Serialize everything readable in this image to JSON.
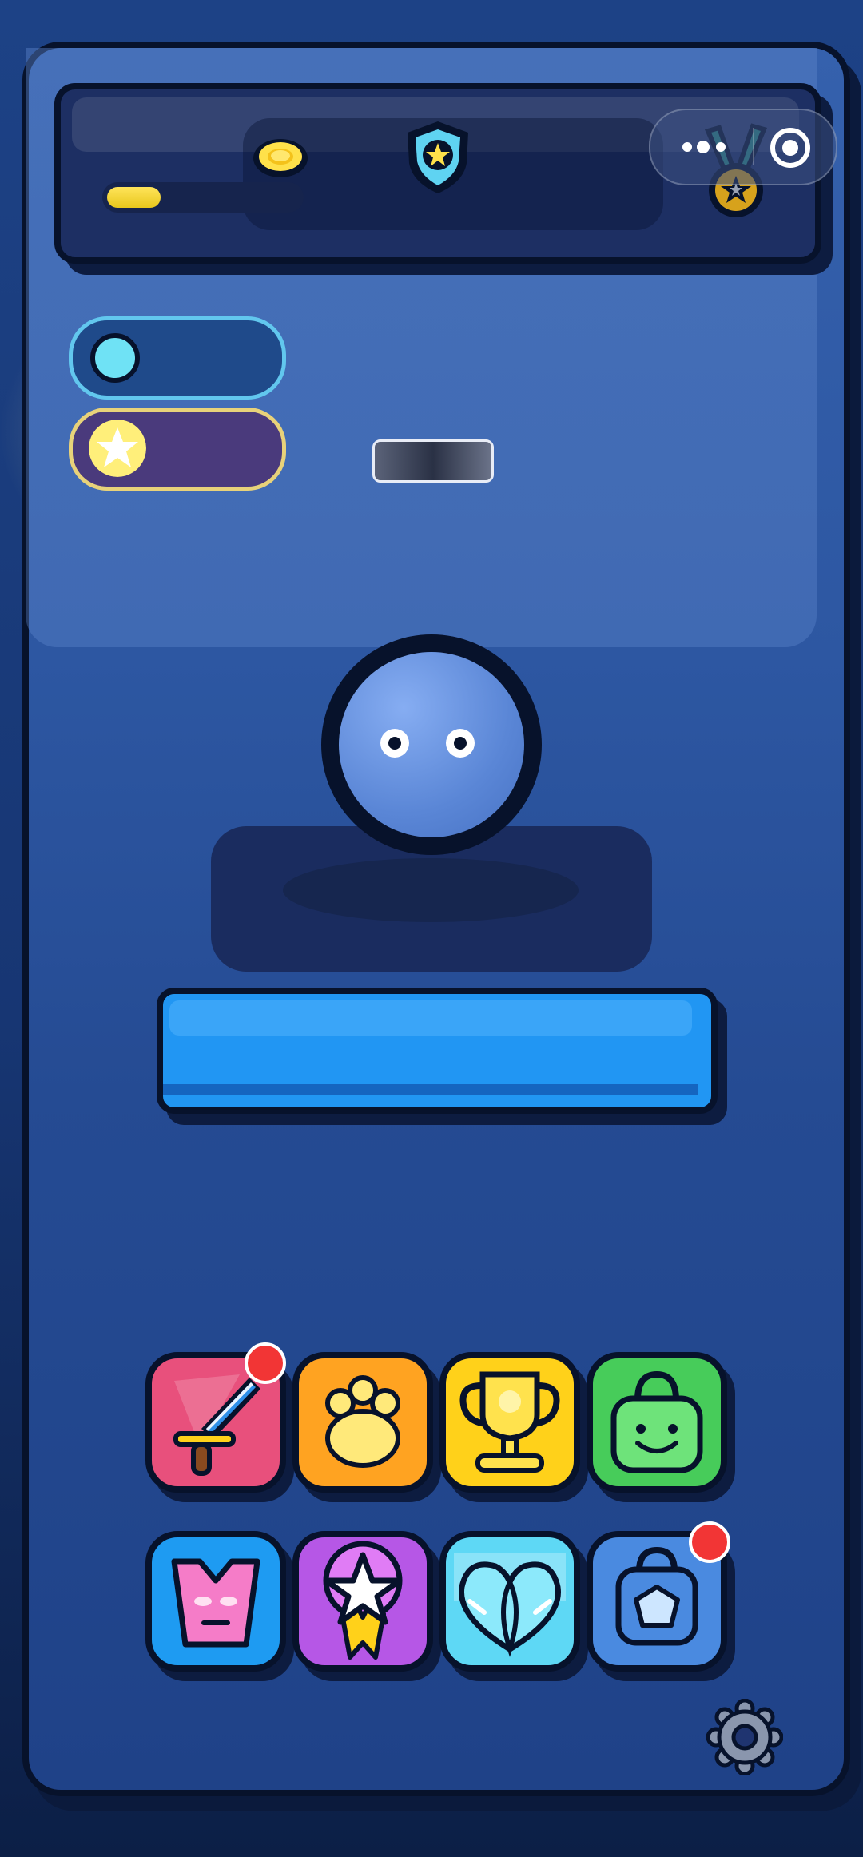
{
  "colors": {
    "background": "#1b3a78",
    "frame_outline": "#07122b",
    "energy": "#6fe2f5",
    "star": "#ffef7a",
    "coin": "#ffe45a",
    "primary_button": "#2196f3",
    "notification_badge": "#f23535"
  },
  "hud": {
    "coin_progress": 0.28,
    "icons": [
      "coin-icon",
      "shield-star-icon",
      "medal-icon"
    ]
  },
  "system_capsule": {
    "icons": [
      "more-dots-icon",
      "record-icon"
    ]
  },
  "side_pills": [
    {
      "icon": "energy-orb-icon",
      "color": "#6fe2f5"
    },
    {
      "icon": "star-icon",
      "color": "#ffef7a"
    }
  ],
  "character": {
    "icon": "blue-blob-character"
  },
  "menu_grid": [
    {
      "icon": "sword-icon",
      "color": "#e8507c",
      "badge": true
    },
    {
      "icon": "paw-icon",
      "color": "#ffa321",
      "badge": false
    },
    {
      "icon": "trophy-icon",
      "color": "#ffd11a",
      "badge": false
    },
    {
      "icon": "shop-bag-icon",
      "color": "#47cc5a",
      "badge": false
    },
    {
      "icon": "armor-icon",
      "color": "#1e9bf2",
      "badge": false
    },
    {
      "icon": "star-medal-icon",
      "color": "#b657e6",
      "badge": false
    },
    {
      "icon": "heart-gem-icon",
      "color": "#5ed8f5",
      "badge": false
    },
    {
      "icon": "gem-bag-icon",
      "color": "#4a8ae0",
      "badge": true
    }
  ],
  "settings": {
    "icon": "gear-icon"
  }
}
